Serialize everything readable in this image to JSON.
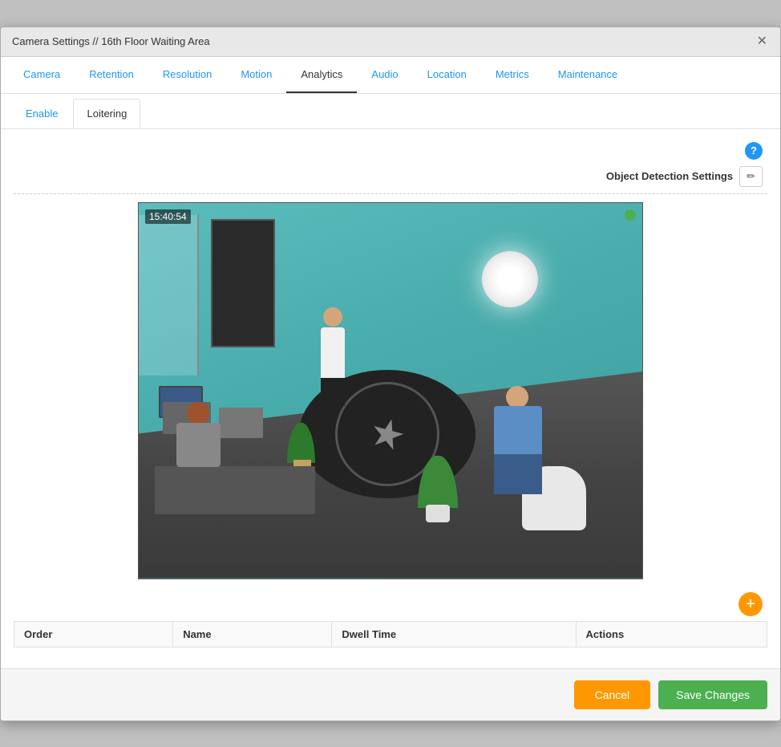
{
  "dialog": {
    "title": "Camera Settings // 16th Floor Waiting Area"
  },
  "tabs": [
    {
      "id": "camera",
      "label": "Camera",
      "active": false
    },
    {
      "id": "retention",
      "label": "Retention",
      "active": false
    },
    {
      "id": "resolution",
      "label": "Resolution",
      "active": false
    },
    {
      "id": "motion",
      "label": "Motion",
      "active": false
    },
    {
      "id": "analytics",
      "label": "Analytics",
      "active": true
    },
    {
      "id": "audio",
      "label": "Audio",
      "active": false
    },
    {
      "id": "location",
      "label": "Location",
      "active": false
    },
    {
      "id": "metrics",
      "label": "Metrics",
      "active": false
    },
    {
      "id": "maintenance",
      "label": "Maintenance",
      "active": false
    }
  ],
  "sub_tabs": [
    {
      "id": "enable",
      "label": "Enable",
      "active": false
    },
    {
      "id": "loitering",
      "label": "Loitering",
      "active": true
    }
  ],
  "object_detection": {
    "label": "Object Detection Settings"
  },
  "camera_feed": {
    "timestamp": "15:40:54"
  },
  "table": {
    "columns": [
      {
        "id": "order",
        "label": "Order"
      },
      {
        "id": "name",
        "label": "Name"
      },
      {
        "id": "dwell_time",
        "label": "Dwell Time"
      },
      {
        "id": "actions",
        "label": "Actions"
      }
    ],
    "rows": []
  },
  "footer": {
    "cancel_label": "Cancel",
    "save_label": "Save Changes"
  },
  "icons": {
    "close": "✕",
    "help": "?",
    "edit": "✏",
    "add": "+"
  }
}
